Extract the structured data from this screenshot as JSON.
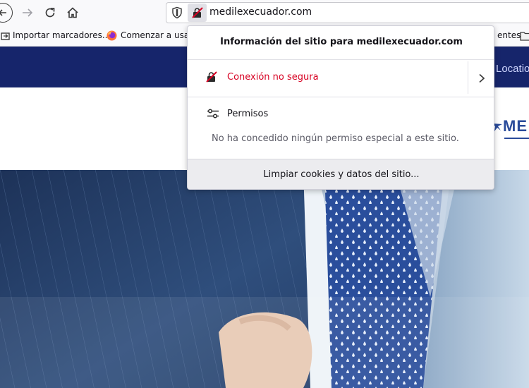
{
  "browser": {
    "url": "medilexecuador.com",
    "bookmarks": {
      "import_label": "Importar marcadores...",
      "start_label": "Comenzar a usar F",
      "partial_label": "entes"
    }
  },
  "page": {
    "nav_location": "Locatio",
    "logo_text": "ME"
  },
  "site_info_popup": {
    "title": "Información del sitio para medilexecuador.com",
    "connection_label": "Conexión no segura",
    "permissions_label": "Permisos",
    "permissions_description": "No ha concedido ningún permiso especial a este sitio.",
    "clear_button_label": "Limpiar cookies y datos del sitio..."
  },
  "colors": {
    "insecure_red": "#d70022",
    "nav_band": "#16256b",
    "logo_blue": "#2a4b9a"
  }
}
